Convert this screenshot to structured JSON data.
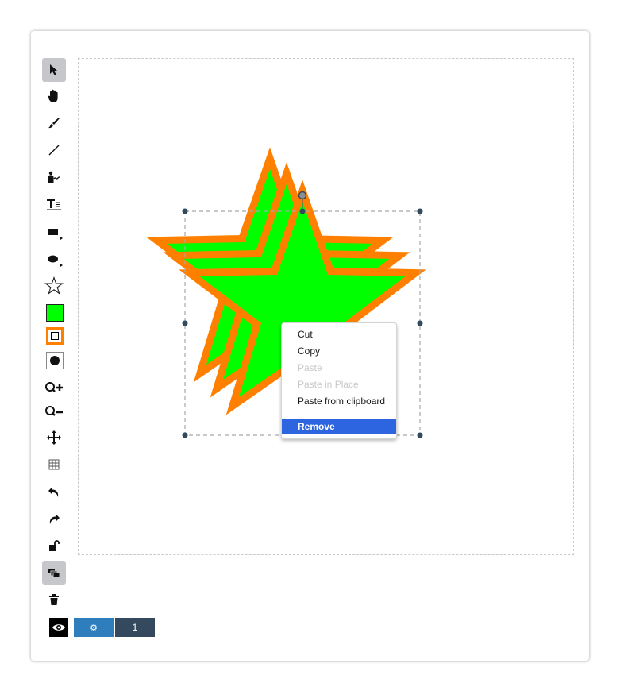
{
  "toolbar": {
    "tools": [
      {
        "name": "select-tool",
        "icon": "cursor-arrow-icon",
        "active": true
      },
      {
        "name": "pan-tool",
        "icon": "hand-icon",
        "active": false
      },
      {
        "name": "brush-tool",
        "icon": "brush-icon",
        "active": false
      },
      {
        "name": "line-tool",
        "icon": "line-icon",
        "active": false
      },
      {
        "name": "stamp-tool",
        "icon": "person-stamp-icon",
        "active": false
      },
      {
        "name": "text-tool",
        "icon": "text-icon",
        "active": false
      },
      {
        "name": "rectangle-tool",
        "icon": "rectangle-icon",
        "active": false
      },
      {
        "name": "ellipse-tool",
        "icon": "ellipse-icon",
        "active": false
      },
      {
        "name": "star-tool",
        "icon": "star-icon",
        "active": false
      }
    ],
    "fill_color": "#00ff00",
    "stroke_color": "#ff8000",
    "stroke_width_icon": "circle-fill-icon"
  },
  "context_menu": {
    "items": [
      {
        "label": "Cut",
        "state": "enabled"
      },
      {
        "label": "Copy",
        "state": "enabled"
      },
      {
        "label": "Paste",
        "state": "disabled"
      },
      {
        "label": "Paste in Place",
        "state": "disabled"
      },
      {
        "label": "Paste from clipboard",
        "state": "enabled"
      },
      {
        "label": "Remove",
        "state": "selected"
      }
    ]
  },
  "bottom_bar": {
    "gear_label": "⚙",
    "layer_label": "1"
  },
  "shape": {
    "fill": "#00ff00",
    "stroke": "#ff8000"
  }
}
